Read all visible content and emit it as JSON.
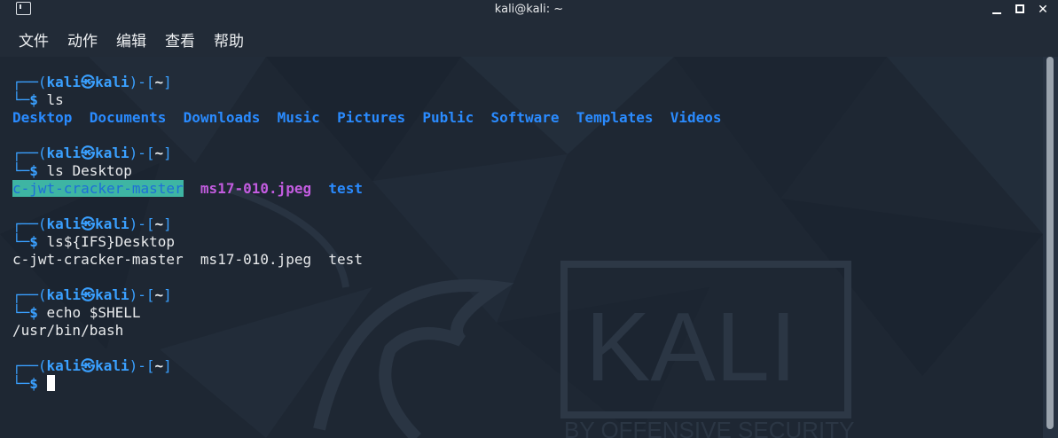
{
  "window": {
    "title": "kali@kali: ~"
  },
  "menu": [
    "文件",
    "动作",
    "编辑",
    "查看",
    "帮助"
  ],
  "prompt": {
    "user": "kali",
    "at_symbol": "㉿",
    "host": "kali",
    "dir": "~",
    "dollar": "$"
  },
  "session": [
    {
      "command": "ls",
      "output": [
        "Desktop",
        "Documents",
        "Downloads",
        "Music",
        "Pictures",
        "Public",
        "Software",
        "Templates",
        "Videos"
      ]
    },
    {
      "command": "ls Desktop",
      "output": [
        "c-jwt-cracker-master",
        "ms17-010.jpeg",
        "test"
      ]
    },
    {
      "command": "ls${IFS}Desktop",
      "output_line": "c-jwt-cracker-master  ms17-010.jpeg  test"
    },
    {
      "command": "echo $SHELL",
      "output_line": "/usr/bin/bash"
    },
    {
      "command": ""
    }
  ],
  "watermark": {
    "brand": "KALI",
    "tagline": "BY OFFENSIVE SECURITY"
  },
  "colors": {
    "prompt": "#3aa0ff",
    "directory": "#2a8bff",
    "image_file": "#c35ce0",
    "highlight": "#3eb5a3"
  }
}
